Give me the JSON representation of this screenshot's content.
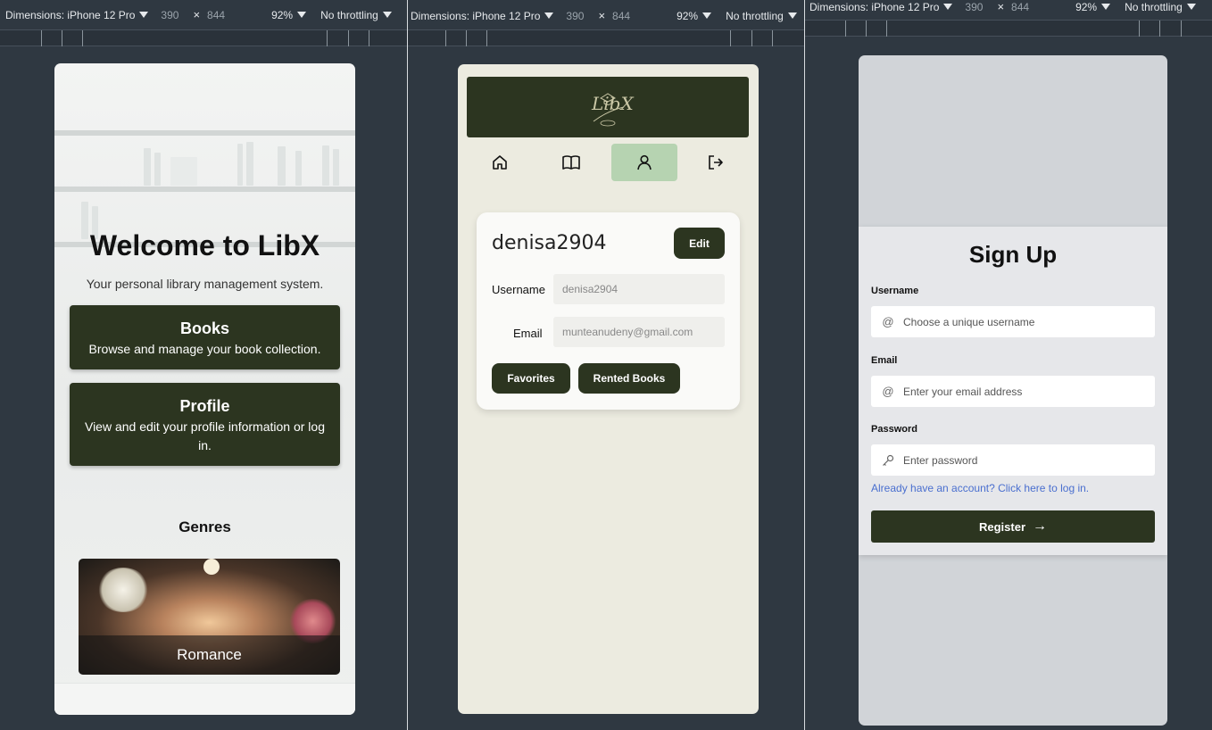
{
  "devtools": {
    "dimensions_label": "Dimensions: iPhone 12 Pro",
    "width": "390",
    "times": "×",
    "height": "844",
    "zoom": "92%",
    "throttling": "No throttling"
  },
  "home": {
    "title": "Welcome to LibX",
    "subtitle": "Your personal library management system.",
    "cards": [
      {
        "title": "Books",
        "desc": "Browse and manage your book collection."
      },
      {
        "title": "Profile",
        "desc": "View and edit your profile information or log in."
      }
    ],
    "genres_title": "Genres",
    "genre_items": [
      {
        "label": "Romance"
      }
    ]
  },
  "profile": {
    "logo": "LibX",
    "nav_icons": [
      "home-icon",
      "book-icon",
      "user-icon",
      "logout-icon"
    ],
    "active_nav": "user-icon",
    "username_display": "denisa2904",
    "edit_label": "Edit",
    "username_label": "Username",
    "username_value": "denisa2904",
    "email_label": "Email",
    "email_value": "munteanudeny@gmail.com",
    "favorites_label": "Favorites",
    "rented_label": "Rented Books"
  },
  "signup": {
    "title": "Sign Up",
    "username_label": "Username",
    "username_placeholder": "Choose a unique username",
    "email_label": "Email",
    "email_placeholder": "Enter your email address",
    "password_label": "Password",
    "password_placeholder": "Enter password",
    "login_link": "Already have an account? Click here to log in.",
    "register_label": "Register",
    "register_arrow": "→"
  },
  "colors": {
    "accent_dark": "#2c3520",
    "active_nav": "#b6d3b1",
    "link": "#4a6fcf"
  }
}
